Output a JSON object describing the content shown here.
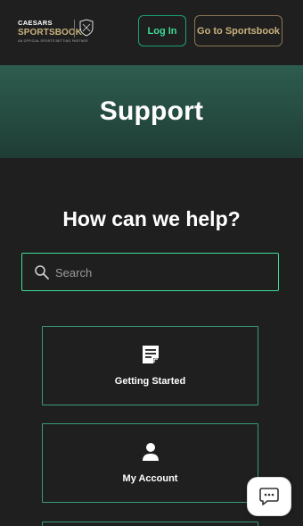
{
  "header": {
    "brand_top": "CAESARS",
    "brand_main": "SPORTSBOOK",
    "partner_text": "AN OFFICIAL SPORTS BETTING PARTNER",
    "login_label": "Log In",
    "sportsbook_label": "Go to Sportsbook"
  },
  "hero": {
    "title": "Support"
  },
  "help": {
    "title": "How can we help?",
    "search_placeholder": "Search"
  },
  "cards": [
    {
      "label": "Getting Started",
      "icon": "document-icon"
    },
    {
      "label": "My Account",
      "icon": "person-icon"
    }
  ],
  "colors": {
    "background": "#1f1f1f",
    "accent_green": "#3ddc97",
    "gold": "#c9b27c",
    "hero_green": "#2d5c4f"
  }
}
